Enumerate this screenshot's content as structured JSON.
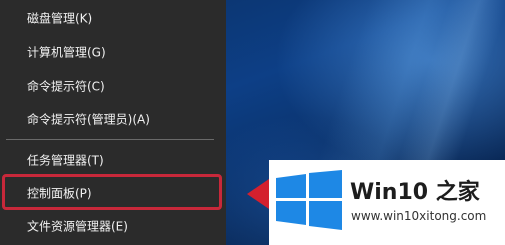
{
  "context_menu": {
    "items": [
      {
        "label": "磁盘管理(K)"
      },
      {
        "label": "计算机管理(G)"
      },
      {
        "label": "命令提示符(C)"
      },
      {
        "label": "命令提示符(管理员)(A)"
      },
      {
        "label": "任务管理器(T)"
      },
      {
        "label": "控制面板(P)"
      },
      {
        "label": "文件资源管理器(E)"
      }
    ],
    "highlighted_item": "控制面板(P)"
  },
  "watermark": {
    "brand_text": "Win10 之家",
    "site_url": "www.win10xitong.com",
    "logo_icon": "windows-logo-icon"
  },
  "colors": {
    "menu_bg": "#2b2b2b",
    "highlight_border": "#c8283a",
    "arrow": "#d4202e",
    "logo_blue": "#1e88e5"
  }
}
